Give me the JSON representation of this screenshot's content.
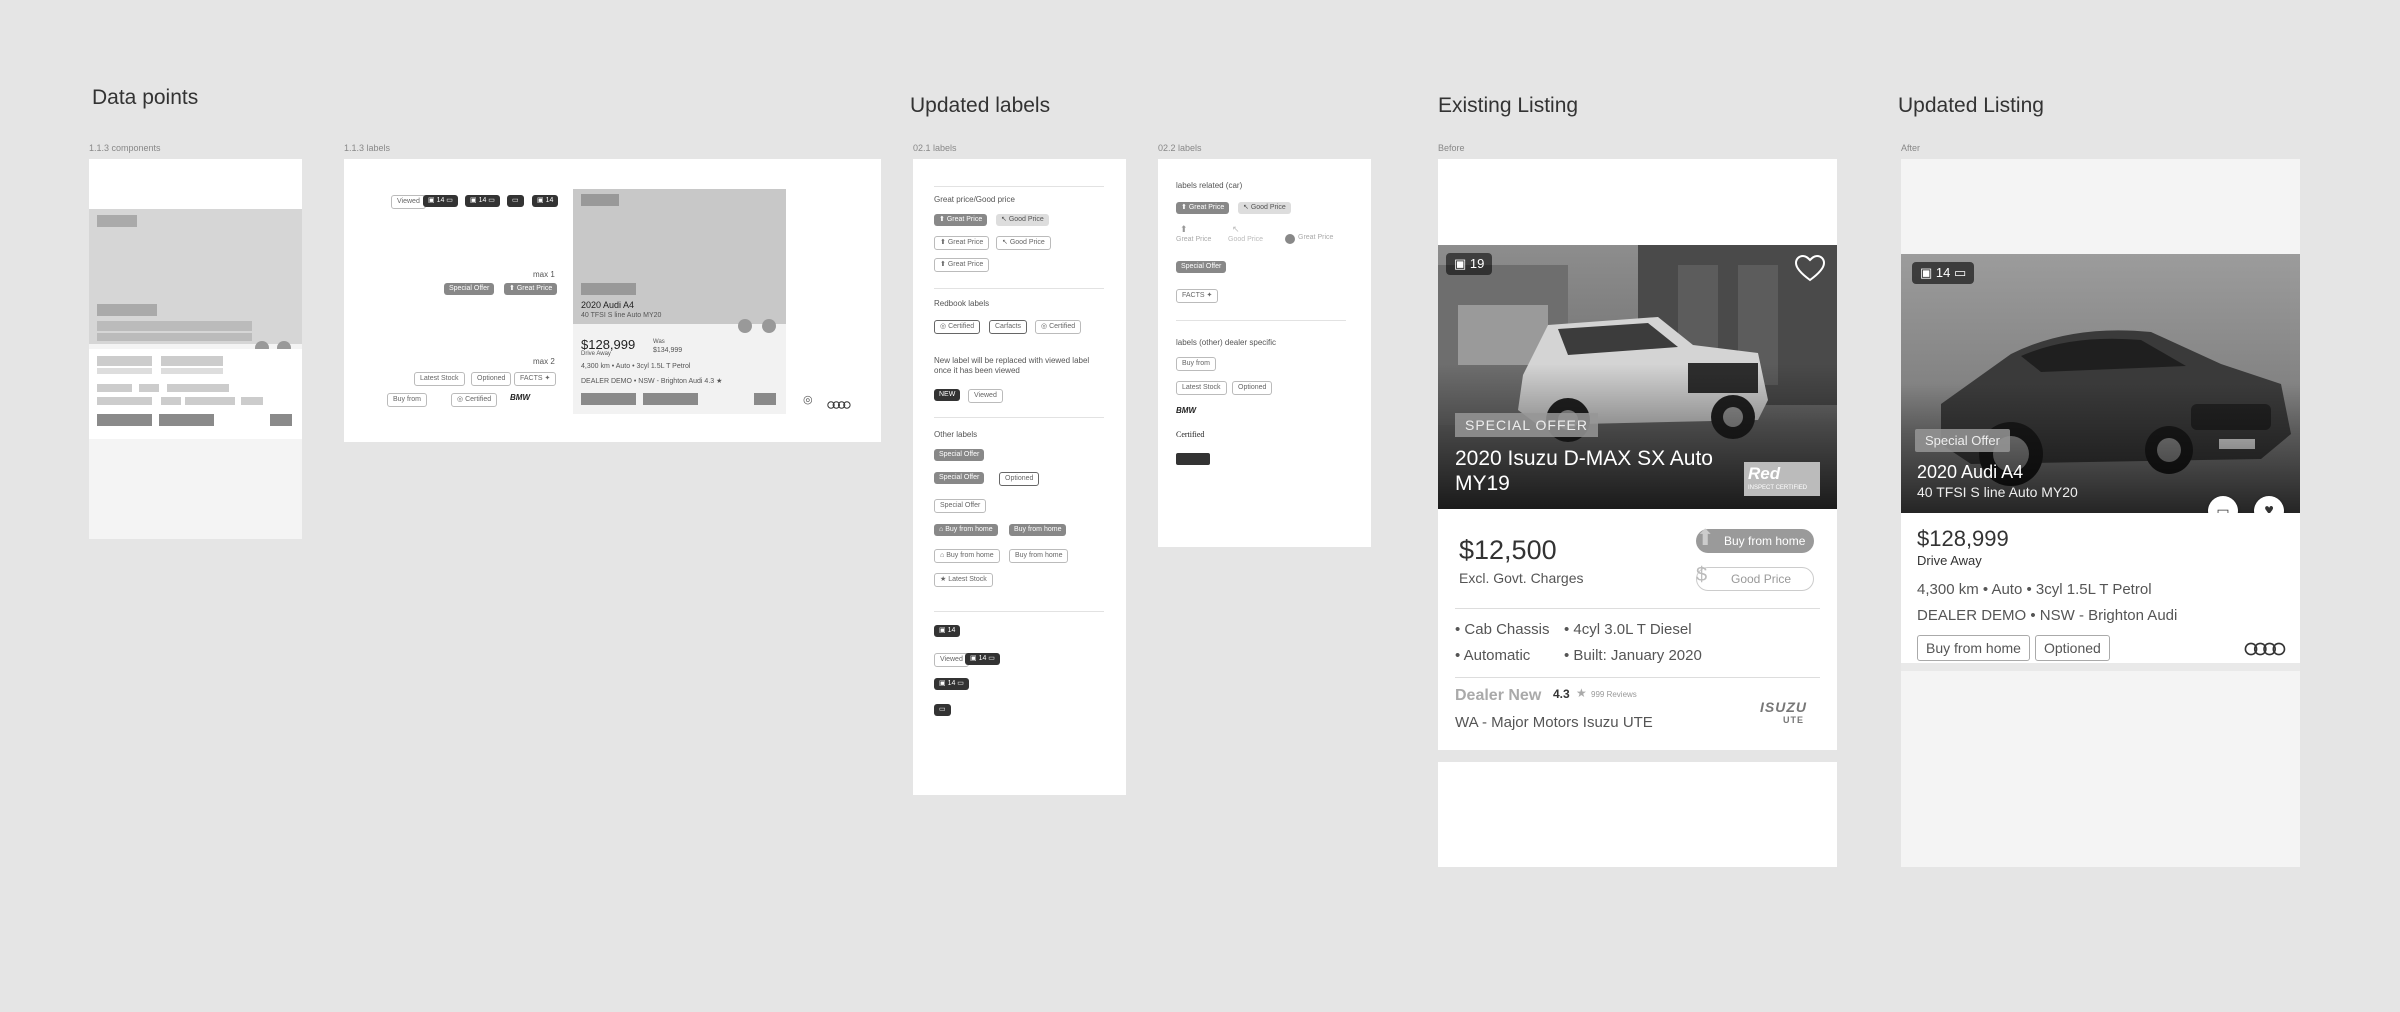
{
  "sections": {
    "data_points": "Data points",
    "updated_labels": "Updated labels",
    "existing_listing": "Existing Listing",
    "updated_listing": "Updated Listing"
  },
  "frames": {
    "components": "1.1.3 components",
    "labels_113": "1.1.3 labels",
    "labels_021": "02.1 labels",
    "labels_022": "02.2 labels",
    "before": "Before",
    "after": "After"
  },
  "wire": {
    "viewed": "Viewed",
    "cam14": "14",
    "max1": "max 1",
    "max2": "max 2",
    "special_offer": "Special Offer",
    "great_price": "Great Price",
    "latest_stock": "Latest Stock",
    "optioned": "Optioned",
    "facts": "FACTS",
    "buy_from": "Buy from",
    "certified": "Certified",
    "bmw": "BMW",
    "car_title": "2020 Audi A4",
    "car_sub": "40 TFSI S line Auto MY20",
    "price": "$128,999",
    "drive_away": "Drive Away",
    "was_label": "Was",
    "was_price": "$134,999",
    "specs": "4,300 km  •  Auto  •  3cyl 1.5L T Petrol",
    "dealer": "DEALER DEMO  •  NSW - Brighton Audi   4.3 ★"
  },
  "labels021": {
    "great_good_heading": "Great price/Good price",
    "great_price": "Great Price",
    "good_price": "Good Price",
    "redbook_heading": "Redbook labels",
    "certified": "Certified",
    "carfacts": "Carfacts",
    "new_label_heading": "New label will be replaced with viewed label once it has been viewed",
    "new": "NEW",
    "viewed": "Viewed",
    "other_heading": "Other labels",
    "special_offer": "Special Offer",
    "optioned": "Optioned",
    "buy_from_home": "Buy from home",
    "latest_stock": "Latest Stock",
    "count": "14"
  },
  "labels022": {
    "car_heading": "labels related (car)",
    "great_price": "Great Price",
    "good_price": "Good Price",
    "special_offer": "Special Offer",
    "facts": "FACTS",
    "dealer_heading": "labels (other) dealer specific",
    "buy_from": "Buy from",
    "latest_stock": "Latest Stock",
    "optioned": "Optioned",
    "bmw": "BMW",
    "certified": "Certified"
  },
  "existing": {
    "photo_count": "19",
    "special_offer": "SPECIAL OFFER",
    "title_line1": "2020 Isuzu D-MAX SX Auto",
    "title_line2": "MY19",
    "redbook_badge": "Red",
    "inspect": "INSPECT CERTIFIED",
    "price": "$12,500",
    "price_note": "Excl. Govt. Charges",
    "buy_from_home": "Buy from home",
    "good_price": "Good Price",
    "spec1": "• Cab Chassis",
    "spec2": "• 4cyl 3.0L T Diesel",
    "spec3": "• Automatic",
    "spec4": "• Built: January 2020",
    "dealer_new": "Dealer New",
    "rating": "4.3",
    "reviews": "999 Reviews",
    "dealer_name": "WA - Major Motors Isuzu UTE",
    "brand_logo_line1": "ISUZU",
    "brand_logo_line2": "UTE"
  },
  "updated": {
    "photo_count": "14",
    "special_offer": "Special Offer",
    "title": "2020 Audi A4",
    "subtitle": "40 TFSI S line Auto MY20",
    "price": "$128,999",
    "drive_away": "Drive Away",
    "specs": "4,300 km  •  Auto  •  3cyl 1.5L T Petrol",
    "dealer": "DEALER DEMO  •  NSW - Brighton Audi",
    "buy_from_home": "Buy from home",
    "optioned": "Optioned"
  }
}
